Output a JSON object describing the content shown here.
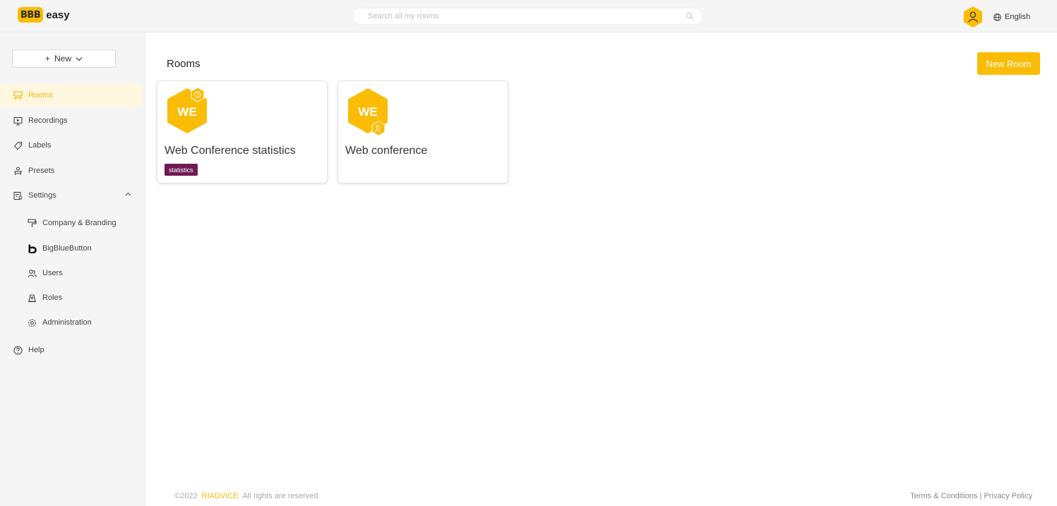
{
  "header": {
    "logo_mark": "BBB",
    "logo_text": "easy",
    "search_placeholder": "Search all my rooms",
    "language": "English"
  },
  "sidebar": {
    "new_label": "New",
    "items": [
      {
        "label": "Rooms",
        "icon": "rooms-icon",
        "active": true
      },
      {
        "label": "Recordings",
        "icon": "recordings-icon"
      },
      {
        "label": "Labels",
        "icon": "tag-icon"
      },
      {
        "label": "Presets",
        "icon": "presets-icon"
      },
      {
        "label": "Settings",
        "icon": "settings-icon",
        "expanded": true
      },
      {
        "label": "Company & Branding",
        "icon": "paint-roller-icon"
      },
      {
        "label": "BigBlueButton",
        "icon": "bigbluebutton-icon"
      },
      {
        "label": "Users",
        "icon": "users-icon"
      },
      {
        "label": "Roles",
        "icon": "roles-icon"
      },
      {
        "label": "Administration",
        "icon": "gear-icon"
      },
      {
        "label": "Help",
        "icon": "help-icon"
      }
    ]
  },
  "main": {
    "title": "Rooms",
    "new_room_label": "New Room",
    "rooms": [
      {
        "initials": "WE",
        "name": "Web Conference statistics",
        "tag": "statistics",
        "badge": "clock-icon"
      },
      {
        "initials": "WE",
        "name": "Web conference",
        "badge": "user-icon"
      }
    ]
  },
  "footer": {
    "copyright": "©2022",
    "brand": "RIADVICE",
    "rights": "All rights are reserved",
    "terms": "Terms & Conditions",
    "separator": "|",
    "privacy": "Privacy Policy"
  },
  "colors": {
    "accent": "#fbbc05",
    "tag": "#6f1a52",
    "active_bg": "#fff7e0"
  }
}
